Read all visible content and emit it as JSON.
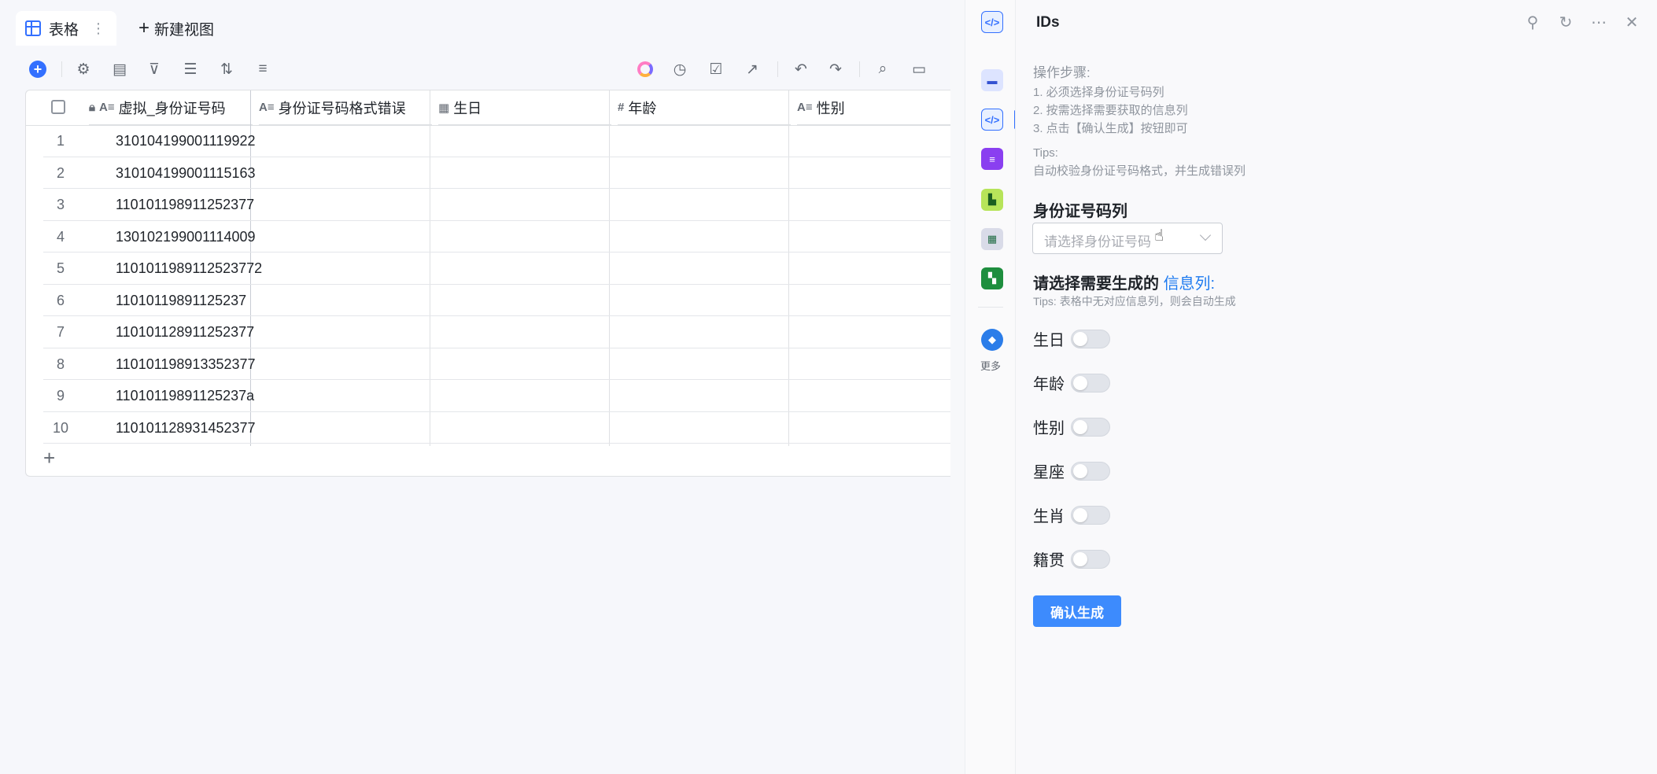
{
  "view_tabs": {
    "active_label": "表格",
    "new_view_label": "新建视图"
  },
  "toolbar": {
    "icons": [
      "add-icon",
      "settings-icon",
      "form-icon",
      "filter-icon",
      "list-icon",
      "sort-icon",
      "row-height-icon",
      "ai-ring-icon",
      "history-icon",
      "check-icon",
      "share-icon",
      "undo-icon",
      "redo-icon",
      "search-icon",
      "comment-icon"
    ]
  },
  "table": {
    "columns": [
      {
        "type_icon": "text-icon",
        "label": "虚拟_身份证号码",
        "locked": true
      },
      {
        "type_icon": "text-icon",
        "label": "身份证号码格式错误"
      },
      {
        "type_icon": "date-icon",
        "label": "生日"
      },
      {
        "type_icon": "number-icon",
        "label": "年龄"
      },
      {
        "type_icon": "text-icon",
        "label": "性别"
      }
    ],
    "rows": [
      {
        "num": "1",
        "id": "310104199001119922"
      },
      {
        "num": "2",
        "id": "310104199001115163"
      },
      {
        "num": "3",
        "id": "110101198911252377"
      },
      {
        "num": "4",
        "id": "130102199001114009"
      },
      {
        "num": "5",
        "id": "1101011989112523772"
      },
      {
        "num": "6",
        "id": "11010119891125237"
      },
      {
        "num": "7",
        "id": "110101128911252377"
      },
      {
        "num": "8",
        "id": "110101198913352377"
      },
      {
        "num": "9",
        "id": "11010119891125237a"
      },
      {
        "num": "10",
        "id": "110101128931452377"
      }
    ]
  },
  "rail": {
    "more_label": "更多"
  },
  "panel": {
    "title": "IDs",
    "steps_heading": "操作步骤:",
    "steps": [
      "1. 必须选择身份证号码列",
      "2. 按需选择需要获取的信息列",
      "3. 点击【确认生成】按钮即可"
    ],
    "tips_heading": "Tips:",
    "tips_text": "自动校验身份证号码格式，并生成错误列",
    "id_column_label": "身份证号码列",
    "id_column_placeholder": "请选择身份证号码",
    "info_label_prefix": "请选择需要生成的",
    "info_label_accent": "信息列:",
    "info_tip": "Tips: 表格中无对应信息列，则会自动生成",
    "switches": [
      "生日",
      "年龄",
      "性别",
      "星座",
      "生肖",
      "籍贯"
    ],
    "confirm_label": "确认生成"
  }
}
